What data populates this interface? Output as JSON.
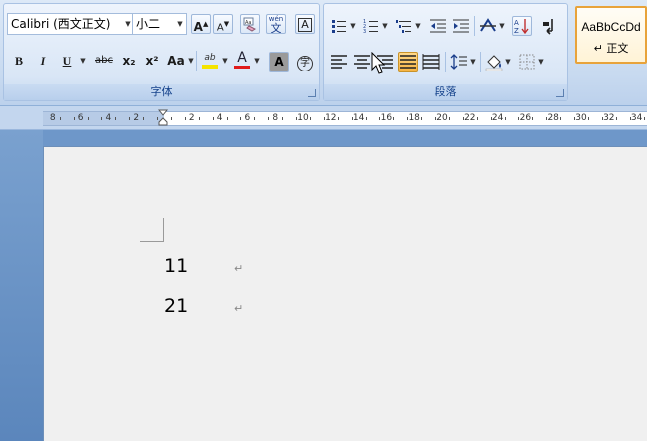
{
  "ribbon": {
    "font_group": {
      "label": "字体",
      "font_name": "Calibri (西文正文)",
      "font_size": "小二",
      "buttons": {
        "grow": "A",
        "shrink": "A",
        "bold": "B",
        "italic": "I",
        "underline": "U",
        "strike": "abc",
        "subscript": "x₂",
        "superscript": "x²",
        "change_case": "Aa",
        "highlight": "ab",
        "font_color": "A",
        "char_shading": "A",
        "enclose": "字"
      }
    },
    "paragraph_group": {
      "label": "段落"
    },
    "styles": {
      "tile_preview": "AaBbCcDd",
      "tile_name": "↵ 正文"
    }
  },
  "ruler": {
    "ticks": [
      "8",
      "6",
      "4",
      "2",
      "2",
      "4",
      "6",
      "8",
      "10",
      "12",
      "14",
      "16",
      "18",
      "20",
      "22",
      "24",
      "26",
      "28",
      "30",
      "32",
      "34"
    ]
  },
  "document": {
    "lines": [
      "11",
      "21"
    ],
    "paragraph_mark": "↵"
  },
  "colors": {
    "highlight": "#f5e400",
    "font_color": "#e01b1b",
    "accent": "#e8a33a"
  }
}
